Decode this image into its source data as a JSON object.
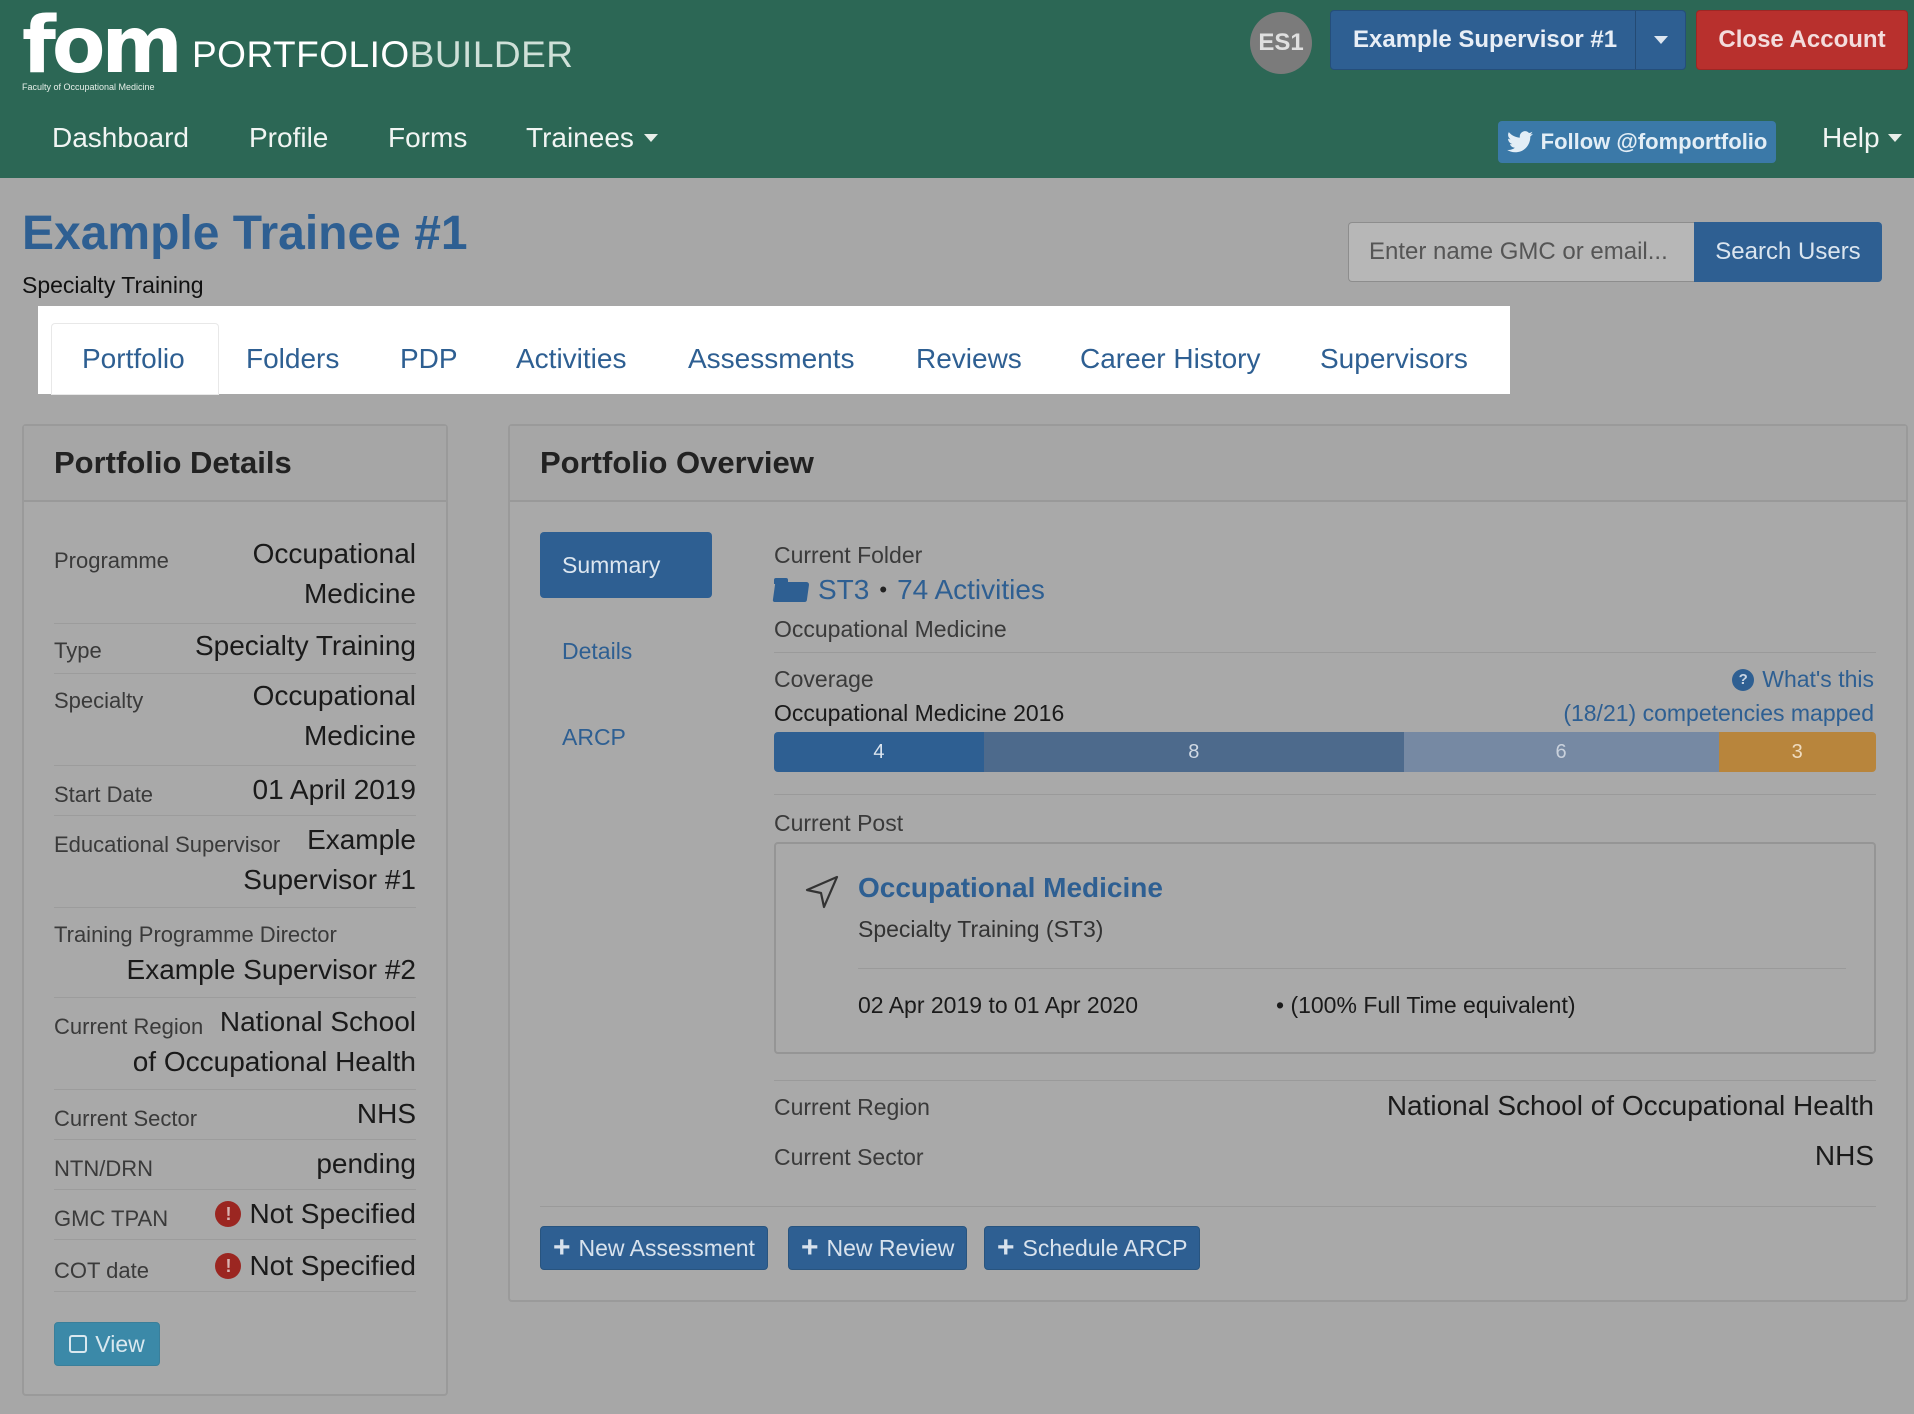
{
  "header": {
    "logo_text": "fom",
    "logo_sub": "Faculty of Occupational Medicine",
    "app_title_part1": "PORTFOLIO",
    "app_title_part2": "BUILDER",
    "avatar_initials": "ES1",
    "user_name": "Example Supervisor #1",
    "close_account": "Close Account"
  },
  "nav": {
    "dashboard": "Dashboard",
    "profile": "Profile",
    "forms": "Forms",
    "trainees": "Trainees",
    "twitter": "Follow @fomportfolio",
    "help": "Help"
  },
  "page": {
    "title": "Example Trainee #1",
    "subtitle": "Specialty Training",
    "search_placeholder": "Enter name GMC or email...",
    "search_button": "Search Users"
  },
  "tabs": [
    "Portfolio",
    "Folders",
    "PDP",
    "Activities",
    "Assessments",
    "Reviews",
    "Career History",
    "Supervisors"
  ],
  "active_tab": "Portfolio",
  "portfolio_details": {
    "heading": "Portfolio Details",
    "programme_label": "Programme",
    "programme_line1": "Occupational",
    "programme_line2": "Medicine",
    "type_label": "Type",
    "type_value": "Specialty Training",
    "specialty_label": "Specialty",
    "specialty_line1": "Occupational",
    "specialty_line2": "Medicine",
    "start_label": "Start Date",
    "start_value": "01 April 2019",
    "es_label": "Educational Supervisor",
    "es_line1": "Example",
    "es_line2": "Supervisor #1",
    "tpd_label": "Training Programme Director",
    "tpd_value": "Example Supervisor #2",
    "region_label": "Current Region",
    "region_line1": "National School",
    "region_line2": "of Occupational Health",
    "sector_label": "Current Sector",
    "sector_value": "NHS",
    "ntn_label": "NTN/DRN",
    "ntn_value": "pending",
    "tpan_label": "GMC TPAN",
    "tpan_value": "Not Specified",
    "cot_label": "COT date",
    "cot_value": "Not Specified",
    "view_button": "View"
  },
  "overview": {
    "heading": "Portfolio Overview",
    "subnav": [
      "Summary",
      "Details",
      "ARCP"
    ],
    "current_folder_label": "Current Folder",
    "folder_name": "ST3",
    "folder_activities": "74 Activities",
    "folder_programme": "Occupational Medicine",
    "coverage_label": "Coverage",
    "coverage_curriculum": "Occupational Medicine 2016",
    "whats_this": "What's this",
    "competencies_mapped": "(18/21) competencies mapped",
    "coverage_segments": [
      {
        "value": 4,
        "color": "#2e5f92",
        "text_color": "#dbe4ee"
      },
      {
        "value": 8,
        "color": "#4d6a8c",
        "text_color": "#d0d9e4"
      },
      {
        "value": 6,
        "color": "#7689a3",
        "text_color": "#c9d1dc"
      },
      {
        "value": 3,
        "color": "#b8853c",
        "text_color": "#efdcc0"
      }
    ],
    "current_post_label": "Current Post",
    "post_title": "Occupational Medicine",
    "post_subtitle": "Specialty Training (ST3)",
    "post_dates": "02 Apr 2019 to 01 Apr 2020",
    "post_fte": "• (100% Full Time equivalent)",
    "region_label": "Current Region",
    "region_value": "National School of Occupational Health",
    "sector_label": "Current Sector",
    "sector_value": "NHS",
    "actions": [
      "New Assessment",
      "New Review",
      "Schedule ARCP"
    ]
  }
}
